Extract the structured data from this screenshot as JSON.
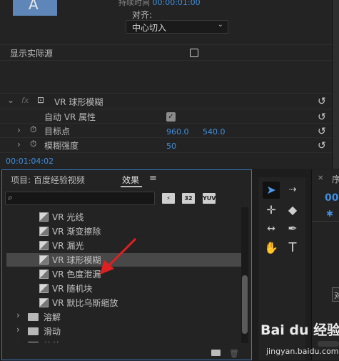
{
  "effect_controls": {
    "clip_thumb_letter": "A",
    "duration_label": "持续时间",
    "duration_value": "00:00:01:00",
    "align_label": "对齐:",
    "align_value": "中心切入",
    "show_source_label": "显示实际源",
    "effect_name": "VR 球形模糊",
    "auto_vr_label": "自动 VR 属性",
    "target_label": "目标点",
    "target_x": "960.0",
    "target_y": "540.0",
    "blur_label": "模糊强度",
    "blur_value": "50",
    "timecode": "00:01:04:02"
  },
  "effects_panel": {
    "tab_project": "项目: 百度经验视频",
    "tab_effects": "效果",
    "menu_glyph": "≡",
    "search_placeholder": "",
    "bin_accelerated": "⚡",
    "bin_32": "32",
    "bin_yuv": "YUV",
    "items": [
      {
        "label": "VR 光线",
        "type": "effect"
      },
      {
        "label": "VR 渐变擦除",
        "type": "effect"
      },
      {
        "label": "VR 漏光",
        "type": "effect"
      },
      {
        "label": "VR 球形模糊",
        "type": "effect",
        "selected": true
      },
      {
        "label": "VR 色度泄漏",
        "type": "effect"
      },
      {
        "label": "VR 随机块",
        "type": "effect"
      },
      {
        "label": "VR 默比乌斯缩放",
        "type": "effect"
      },
      {
        "label": "溶解",
        "type": "folder"
      },
      {
        "label": "滑动",
        "type": "folder"
      },
      {
        "label": "缩放",
        "type": "folder"
      }
    ]
  },
  "timeline_panel": {
    "title_fragment": "序",
    "timecode_fragment": "00",
    "label_fragment": "对"
  },
  "watermark": {
    "main": "Bai du 经验",
    "sub": "jingyan.baidu.com"
  },
  "colors": {
    "accent_blue": "#3f8fe0",
    "panel_focus_border": "#3a78c2",
    "arrow_red": "#e02020"
  }
}
